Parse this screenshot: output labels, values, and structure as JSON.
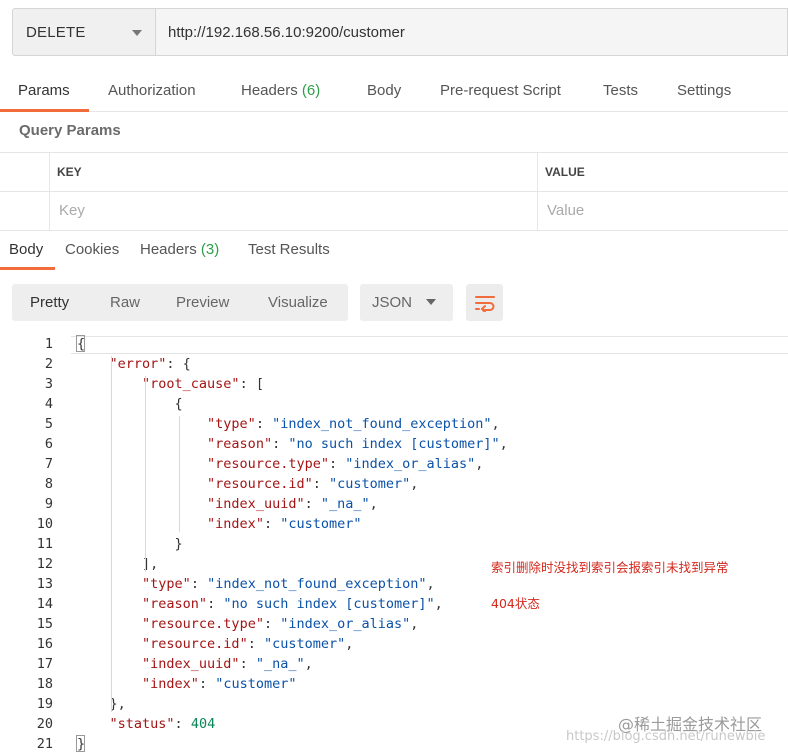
{
  "request": {
    "method": "DELETE",
    "url": "http://192.168.56.10:9200/customer"
  },
  "request_tabs": {
    "params": "Params",
    "authorization": "Authorization",
    "headers": "Headers",
    "headers_count": "(6)",
    "body": "Body",
    "prerequest": "Pre-request Script",
    "tests": "Tests",
    "settings": "Settings"
  },
  "query_params": {
    "title": "Query Params",
    "key_header": "KEY",
    "value_header": "VALUE",
    "key_placeholder": "Key",
    "value_placeholder": "Value"
  },
  "response_tabs": {
    "body": "Body",
    "cookies": "Cookies",
    "headers": "Headers",
    "headers_count": "(3)",
    "test_results": "Test Results"
  },
  "format_buttons": {
    "pretty": "Pretty",
    "raw": "Raw",
    "preview": "Preview",
    "visualize": "Visualize",
    "language": "JSON"
  },
  "icons": {
    "dropdown": "chevron-down-icon",
    "wrap": "wrap-lines-icon"
  },
  "colors": {
    "accent": "#f26b3a",
    "count_green": "#2d9e49",
    "json_key": "#a31515",
    "json_string": "#0b52a8",
    "json_number": "#098658",
    "annotation_red": "#d4281c"
  },
  "response": {
    "line_numbers": [
      "1",
      "2",
      "3",
      "4",
      "5",
      "6",
      "7",
      "8",
      "9",
      "10",
      "11",
      "12",
      "13",
      "14",
      "15",
      "16",
      "17",
      "18",
      "19",
      "20",
      "21"
    ],
    "lines": [
      [
        {
          "t": "p",
          "v": "{"
        }
      ],
      [
        {
          "t": "p",
          "v": "    "
        },
        {
          "t": "k",
          "v": "\"error\""
        },
        {
          "t": "p",
          "v": ": {"
        }
      ],
      [
        {
          "t": "p",
          "v": "        "
        },
        {
          "t": "k",
          "v": "\"root_cause\""
        },
        {
          "t": "p",
          "v": ": ["
        }
      ],
      [
        {
          "t": "p",
          "v": "            {"
        }
      ],
      [
        {
          "t": "p",
          "v": "                "
        },
        {
          "t": "k",
          "v": "\"type\""
        },
        {
          "t": "p",
          "v": ": "
        },
        {
          "t": "s",
          "v": "\"index_not_found_exception\""
        },
        {
          "t": "p",
          "v": ","
        }
      ],
      [
        {
          "t": "p",
          "v": "                "
        },
        {
          "t": "k",
          "v": "\"reason\""
        },
        {
          "t": "p",
          "v": ": "
        },
        {
          "t": "s",
          "v": "\"no such index [customer]\""
        },
        {
          "t": "p",
          "v": ","
        }
      ],
      [
        {
          "t": "p",
          "v": "                "
        },
        {
          "t": "k",
          "v": "\"resource.type\""
        },
        {
          "t": "p",
          "v": ": "
        },
        {
          "t": "s",
          "v": "\"index_or_alias\""
        },
        {
          "t": "p",
          "v": ","
        }
      ],
      [
        {
          "t": "p",
          "v": "                "
        },
        {
          "t": "k",
          "v": "\"resource.id\""
        },
        {
          "t": "p",
          "v": ": "
        },
        {
          "t": "s",
          "v": "\"customer\""
        },
        {
          "t": "p",
          "v": ","
        }
      ],
      [
        {
          "t": "p",
          "v": "                "
        },
        {
          "t": "k",
          "v": "\"index_uuid\""
        },
        {
          "t": "p",
          "v": ": "
        },
        {
          "t": "s",
          "v": "\"_na_\""
        },
        {
          "t": "p",
          "v": ","
        }
      ],
      [
        {
          "t": "p",
          "v": "                "
        },
        {
          "t": "k",
          "v": "\"index\""
        },
        {
          "t": "p",
          "v": ": "
        },
        {
          "t": "s",
          "v": "\"customer\""
        }
      ],
      [
        {
          "t": "p",
          "v": "            }"
        }
      ],
      [
        {
          "t": "p",
          "v": "        ],"
        }
      ],
      [
        {
          "t": "p",
          "v": "        "
        },
        {
          "t": "k",
          "v": "\"type\""
        },
        {
          "t": "p",
          "v": ": "
        },
        {
          "t": "s",
          "v": "\"index_not_found_exception\""
        },
        {
          "t": "p",
          "v": ","
        }
      ],
      [
        {
          "t": "p",
          "v": "        "
        },
        {
          "t": "k",
          "v": "\"reason\""
        },
        {
          "t": "p",
          "v": ": "
        },
        {
          "t": "s",
          "v": "\"no such index [customer]\""
        },
        {
          "t": "p",
          "v": ","
        }
      ],
      [
        {
          "t": "p",
          "v": "        "
        },
        {
          "t": "k",
          "v": "\"resource.type\""
        },
        {
          "t": "p",
          "v": ": "
        },
        {
          "t": "s",
          "v": "\"index_or_alias\""
        },
        {
          "t": "p",
          "v": ","
        }
      ],
      [
        {
          "t": "p",
          "v": "        "
        },
        {
          "t": "k",
          "v": "\"resource.id\""
        },
        {
          "t": "p",
          "v": ": "
        },
        {
          "t": "s",
          "v": "\"customer\""
        },
        {
          "t": "p",
          "v": ","
        }
      ],
      [
        {
          "t": "p",
          "v": "        "
        },
        {
          "t": "k",
          "v": "\"index_uuid\""
        },
        {
          "t": "p",
          "v": ": "
        },
        {
          "t": "s",
          "v": "\"_na_\""
        },
        {
          "t": "p",
          "v": ","
        }
      ],
      [
        {
          "t": "p",
          "v": "        "
        },
        {
          "t": "k",
          "v": "\"index\""
        },
        {
          "t": "p",
          "v": ": "
        },
        {
          "t": "s",
          "v": "\"customer\""
        }
      ],
      [
        {
          "t": "p",
          "v": "    },"
        }
      ],
      [
        {
          "t": "p",
          "v": "    "
        },
        {
          "t": "k",
          "v": "\"status\""
        },
        {
          "t": "p",
          "v": ": "
        },
        {
          "t": "n",
          "v": "404"
        }
      ],
      [
        {
          "t": "p",
          "v": "}"
        }
      ]
    ]
  },
  "annotations": {
    "line1": "索引删除时没找到索引会报索引未找到异常",
    "line2": "404状态"
  },
  "watermark": {
    "text": "@稀土掘金技术社区",
    "url": "https://blog.csdn.net/runewbie"
  }
}
